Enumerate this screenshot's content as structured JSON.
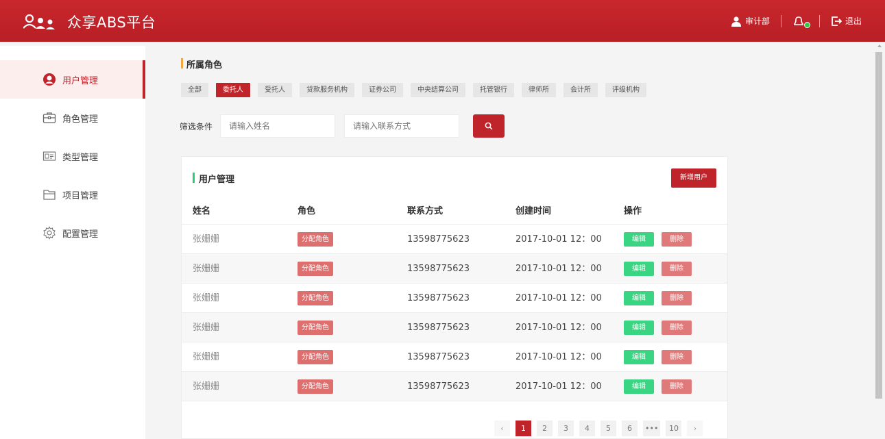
{
  "header": {
    "logo_text": "众享ABS平台",
    "user": "审计部",
    "logout": "退出"
  },
  "sidebar": {
    "items": [
      {
        "label": "用户管理",
        "icon": "user-circle-icon",
        "active": true
      },
      {
        "label": "角色管理",
        "icon": "briefcase-icon",
        "active": false
      },
      {
        "label": "类型管理",
        "icon": "id-card-icon",
        "active": false
      },
      {
        "label": "项目管理",
        "icon": "folder-icon",
        "active": false
      },
      {
        "label": "配置管理",
        "icon": "gear-icon",
        "active": false
      }
    ]
  },
  "roles": {
    "title": "所属角色",
    "tags": [
      "全部",
      "委托人",
      "受托人",
      "贷款服务机构",
      "证券公司",
      "中央结算公司",
      "托管银行",
      "律师所",
      "会计所",
      "评级机构"
    ],
    "active_index": 1
  },
  "filter": {
    "label": "筛选条件",
    "name_placeholder": "请输入姓名",
    "contact_placeholder": "请输入联系方式"
  },
  "panel": {
    "title": "用户管理",
    "add_button": "新增用户",
    "columns": {
      "name": "姓名",
      "role": "角色",
      "contact": "联系方式",
      "created": "创建时间",
      "ops": "操作"
    },
    "rows": [
      {
        "name": "张姗姗",
        "role_btn": "分配角色",
        "phone": "13598775623",
        "time": "2017-10-01 12：00",
        "edit": "编辑",
        "delete": "删除"
      },
      {
        "name": "张姗姗",
        "role_btn": "分配角色",
        "phone": "13598775623",
        "time": "2017-10-01 12：00",
        "edit": "编辑",
        "delete": "删除"
      },
      {
        "name": "张姗姗",
        "role_btn": "分配角色",
        "phone": "13598775623",
        "time": "2017-10-01 12：00",
        "edit": "编辑",
        "delete": "删除"
      },
      {
        "name": "张姗姗",
        "role_btn": "分配角色",
        "phone": "13598775623",
        "time": "2017-10-01 12：00",
        "edit": "编辑",
        "delete": "删除"
      },
      {
        "name": "张姗姗",
        "role_btn": "分配角色",
        "phone": "13598775623",
        "time": "2017-10-01 12：00",
        "edit": "编辑",
        "delete": "删除"
      },
      {
        "name": "张姗姗",
        "role_btn": "分配角色",
        "phone": "13598775623",
        "time": "2017-10-01 12：00",
        "edit": "编辑",
        "delete": "删除"
      }
    ]
  },
  "pagination": {
    "prev": "‹",
    "pages": [
      "1",
      "2",
      "3",
      "4",
      "5",
      "6",
      "•••",
      "10"
    ],
    "active": "1",
    "next": "›"
  },
  "colors": {
    "brand_red": "#c0242b",
    "accent_orange": "#f4a73a",
    "accent_green": "#2ecc71"
  }
}
